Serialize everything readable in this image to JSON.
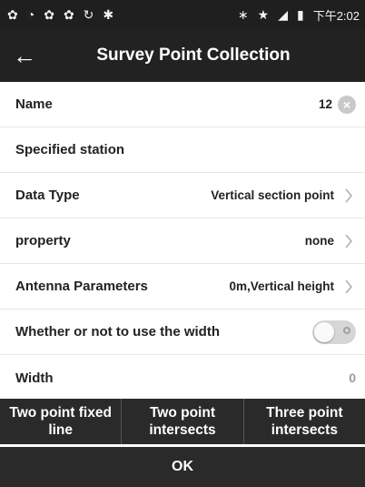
{
  "status_bar": {
    "time": "下午2:02",
    "icons": [
      "app-icon",
      "wifi-icon",
      "app-icon",
      "app-icon",
      "sync-icon",
      "debug-icon",
      "bluetooth-icon",
      "star-icon",
      "signal-icon",
      "battery-icon"
    ]
  },
  "toolbar": {
    "title": "Survey Point Collection",
    "back_icon": "arrow-left-icon"
  },
  "form": {
    "name_label": "Name",
    "name_value": "12",
    "station_label": "Specified station",
    "data_type_label": "Data Type",
    "data_type_value": "Vertical section point",
    "property_label": "property",
    "property_value": "none",
    "antenna_label": "Antenna Parameters",
    "antenna_value": "0m,Vertical height",
    "use_width_label": "Whether or not to use the width",
    "use_width_on": false,
    "width_label": "Width",
    "width_value": "0"
  },
  "buttons": {
    "two_point_fixed": "Two point fixed line",
    "two_point_intersects": "Two point intersects",
    "three_point_intersects": "Three point intersects",
    "ok": "OK"
  },
  "colors": {
    "bar": "#222222",
    "chevron": "#b0b0b0"
  }
}
